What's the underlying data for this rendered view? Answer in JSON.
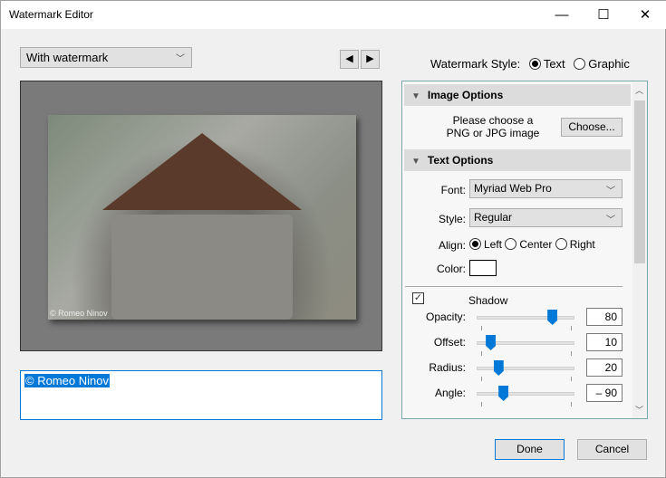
{
  "window": {
    "title": "Watermark Editor",
    "minimize": "—",
    "maximize": "☐",
    "close": "✕"
  },
  "preset": {
    "value": "With watermark"
  },
  "nav": {
    "prev": "◀",
    "next": "▶"
  },
  "preview": {
    "watermark_text": "© Romeo Ninov"
  },
  "watermark_text_input": {
    "value": "© Romeo Ninov"
  },
  "style": {
    "label": "Watermark Style:",
    "options": [
      "Text",
      "Graphic"
    ],
    "selected": "Text"
  },
  "image_options": {
    "header": "Image Options",
    "hint_line1": "Please choose a",
    "hint_line2": "PNG or JPG image",
    "choose": "Choose..."
  },
  "text_options": {
    "header": "Text Options",
    "font_label": "Font:",
    "font": "Myriad Web Pro",
    "style_label": "Style:",
    "style": "Regular",
    "align_label": "Align:",
    "align_options": [
      "Left",
      "Center",
      "Right"
    ],
    "align_selected": "Left",
    "color_label": "Color:",
    "color": "#ffffff"
  },
  "shadow": {
    "label": "Shadow",
    "checked": true,
    "sliders": [
      {
        "label": "Opacity:",
        "value": "80",
        "position_pct": 77
      },
      {
        "label": "Offset:",
        "value": "10",
        "position_pct": 14
      },
      {
        "label": "Radius:",
        "value": "20",
        "position_pct": 22
      },
      {
        "label": "Angle:",
        "value": "– 90",
        "position_pct": 27
      }
    ]
  },
  "footer": {
    "done": "Done",
    "cancel": "Cancel"
  },
  "colors": {
    "accent": "#0078d7",
    "panel_border": "#7aa9ad"
  }
}
